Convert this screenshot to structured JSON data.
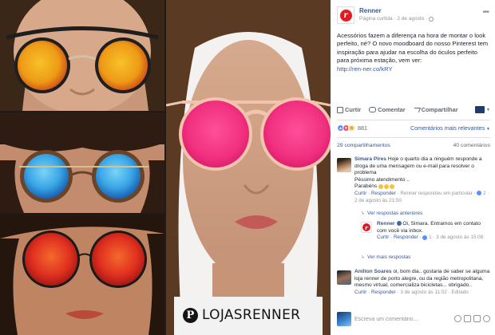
{
  "photos": {
    "watermark": "LOJASRENNER",
    "tiles": [
      {
        "name": "photo-orange-lens-sunglasses",
        "lens_color": "#f0a018",
        "lens_edge": "#d0541c",
        "frame": "#2b2b2b"
      },
      {
        "name": "photo-blue-lens-sunglasses",
        "lens_color": "#48b6ec",
        "lens_edge": "#1e74c8",
        "frame": "#5a3a22"
      },
      {
        "name": "photo-red-lens-sunglasses",
        "lens_color": "#e8321e",
        "lens_edge": "#a8180c",
        "frame": "#1c1c1c"
      },
      {
        "name": "photo-pink-lens-sunglasses",
        "lens_color": "#f0307e",
        "lens_edge": "#ff7ab8",
        "frame": "#f2c4ae"
      }
    ]
  },
  "post": {
    "page_name": "Renner",
    "meta": "Página curtida · 2 de agosto ·",
    "menu_icon": "more-icon",
    "text": "Acessórios fazem a diferença na hora de montar o look perfeito, né? O novo moodboard do nosso Pinterest tem inspiração para ajudar na escolha do óculos perfeito para próxima estação, vem ver:",
    "link": "http://ren-ner.co/kRY",
    "actions": {
      "like": "Curtir",
      "comment": "Comentar",
      "share": "Compartilhar"
    },
    "reaction_count": "881",
    "sort_label": "Comentários mais relevantes",
    "shares": "29 compartilhamentos",
    "comments_count": "40 comentários"
  },
  "comments": [
    {
      "author": "Simara Pires",
      "text": "Hoje o quarto dia a ninguém responde a droga de uma mensagem ou e-mail para resolver o problema",
      "text2": "Péssimo atendimento ..",
      "text3": "Parabéns",
      "actions": "Curtir · Responder",
      "meta": "Renner respondeu em particular",
      "likes": "2",
      "time": "· 2 de agosto às 21:50",
      "view_replies": "Ver respostas anteriores"
    },
    {
      "author": "Renner",
      "text": "Oi, Simara. Entramos em contato com você via inbox.",
      "actions": "Curtir · Responder ·",
      "likes": "1",
      "time": "· 3 de agosto às 15:08",
      "view_more": "Ver mais respostas"
    },
    {
      "author": "Anilton Soares",
      "text": "oi, bom dia.. gostaria de saber se alguma loja renner de porto alegre, ou da região metropolitana, mesmo virtual, comercializa bicicletas... obrigado..",
      "actions": "Curtir · Responder",
      "time": "· 3 de agosto às 11:02 · Editado"
    }
  ],
  "composer": {
    "placeholder": "Escreva um comentário..."
  }
}
